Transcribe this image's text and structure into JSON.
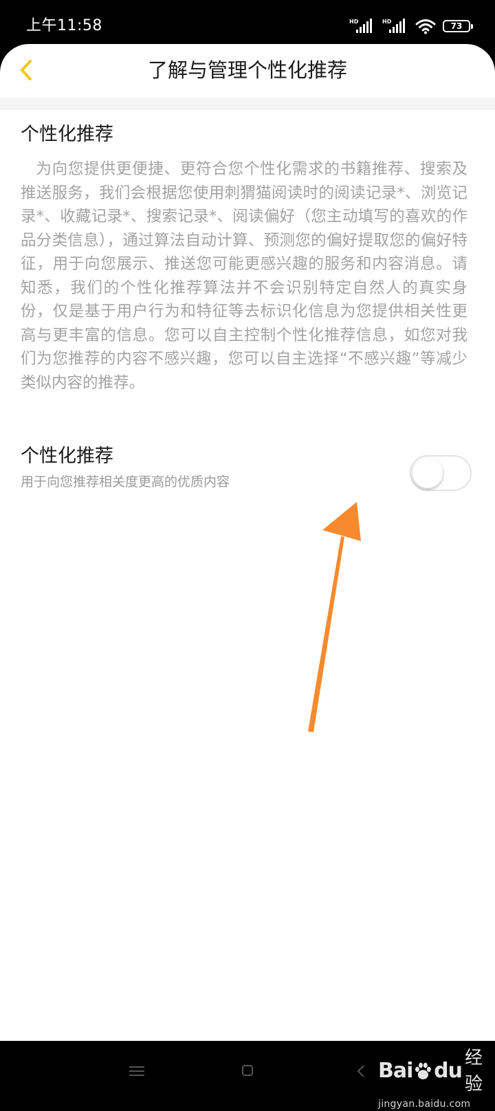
{
  "status_bar": {
    "time": "上午11:58",
    "signal_label": "HD",
    "battery_level": "73"
  },
  "header": {
    "title": "了解与管理个性化推荐",
    "back_icon": "chevron-left-icon",
    "accent_color": "#F5C518"
  },
  "intro": {
    "title": "个性化推荐",
    "description": "为向您提供更便捷、更符合您个性化需求的书籍推荐、搜索及推送服务，我们会根据您使用刺猬猫阅读时的阅读记录*、浏览记录*、收藏记录*、搜索记录*、阅读偏好（您主动填写的喜欢的作品分类信息），通过算法自动计算、预测您的偏好提取您的偏好特征，用于向您展示、推送您可能更感兴趣的服务和内容消息。请知悉，我们的个性化推荐算法并不会识别特定自然人的真实身份，仅是基于用户行为和特征等去标识化信息为您提供相关性更高与更丰富的信息。您可以自主控制个性化推荐信息，如您对我们为您推荐的内容不感兴趣，您可以自主选择“不感兴趣”等减少类似内容的推荐。"
  },
  "setting": {
    "title": "个性化推荐",
    "subtitle": "用于向您推荐相关度更高的优质内容",
    "toggle_on": false
  },
  "annotation": {
    "arrow_color": "#F78A2E"
  },
  "navbar": {
    "icons": [
      "menu-icon",
      "home-icon",
      "back-icon"
    ]
  },
  "watermark": {
    "logo_left": "Bai",
    "logo_right": "du",
    "chinese": "经验",
    "url": "jingyan.baidu.com"
  }
}
